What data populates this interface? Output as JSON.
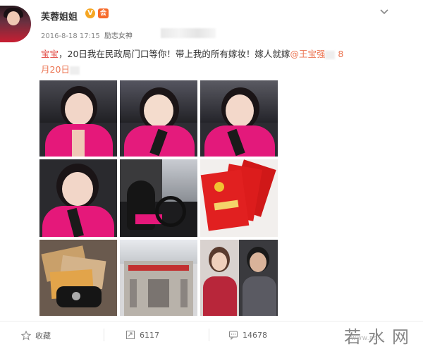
{
  "user": {
    "name": "芙蓉姐姐",
    "verified_badge": "V",
    "vip_badge": "会"
  },
  "meta": {
    "timestamp": "2016-8-18 17:15",
    "source_label": "励志女神"
  },
  "post": {
    "text_red": "宝宝",
    "text_main": "，20日我在民政局门口等你！带上我的所有嫁妆！嫁人就嫁",
    "mention": "@王宝强",
    "text_tail_1": " 8",
    "text_tail_2": "月20日"
  },
  "photos": [
    {
      "name": "selfie-car-1"
    },
    {
      "name": "selfie-car-2"
    },
    {
      "name": "selfie-car-3"
    },
    {
      "name": "selfie-car-4"
    },
    {
      "name": "driving-photo"
    },
    {
      "name": "red-certificates"
    },
    {
      "name": "car-keys-cards"
    },
    {
      "name": "civil-affairs-building"
    },
    {
      "name": "couple-portrait"
    }
  ],
  "actions": {
    "favorite_label": "收藏",
    "forward_count": "6117",
    "comment_count": "14678"
  },
  "watermark": {
    "text": "若水网",
    "sub": "WWW.RS..."
  },
  "icons": {
    "menu": "chevron-down-icon",
    "favorite": "star-icon",
    "forward": "forward-icon",
    "comment": "comment-icon"
  },
  "colors": {
    "mention": "#eb7350",
    "highlight": "#e0403a",
    "vip": "#f66a2a",
    "verified": "#f5a623"
  }
}
